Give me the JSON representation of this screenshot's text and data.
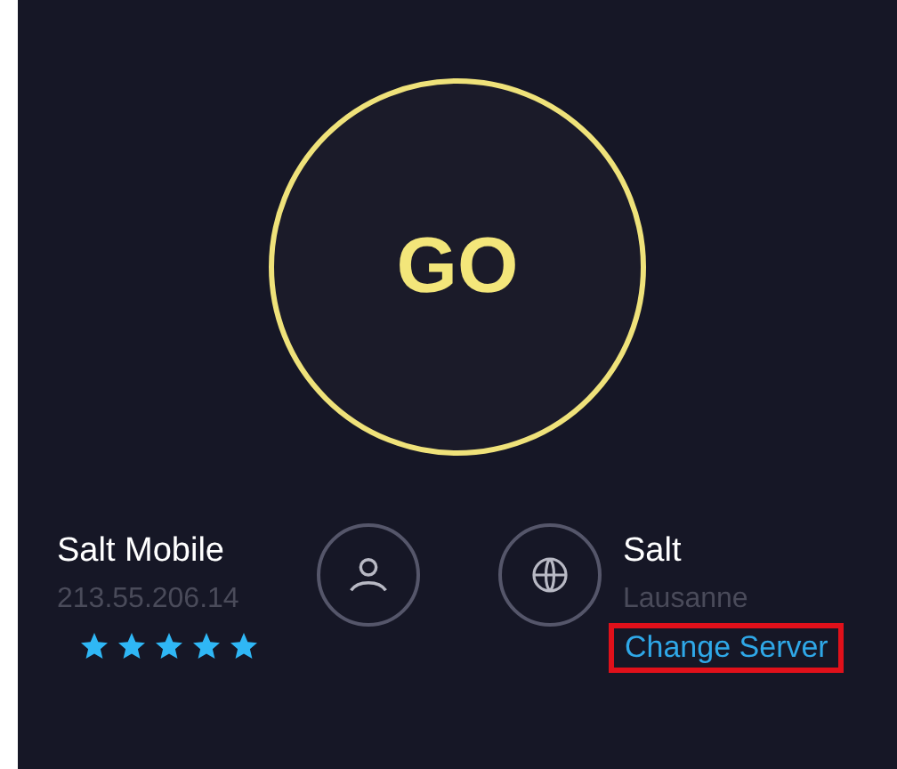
{
  "go_button": {
    "label": "GO"
  },
  "provider": {
    "name": "Salt Mobile",
    "ip": "213.55.206.14",
    "stars": 5
  },
  "server": {
    "name": "Salt",
    "location": "Lausanne",
    "change_link": "Change Server",
    "highlighted": true
  }
}
